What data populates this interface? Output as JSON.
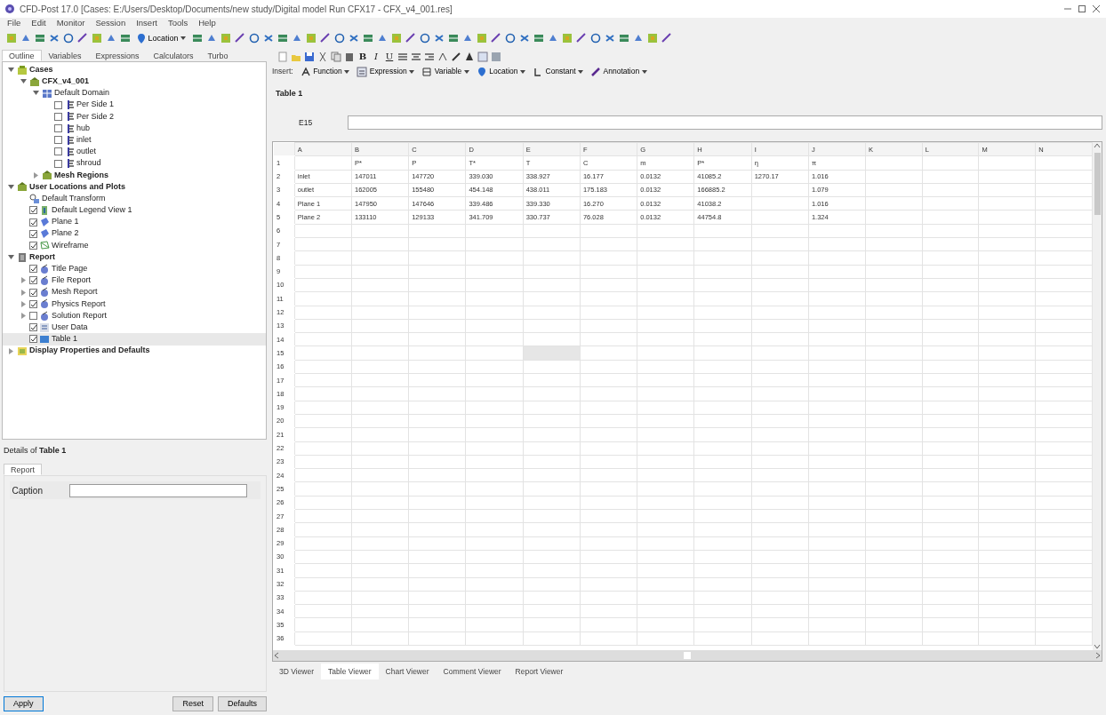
{
  "window": {
    "title": "CFD-Post 17.0 [Cases: E:/Users/Desktop/Documents/new study/Digital model Run CFX17 - CFX_v4_001.res]"
  },
  "menu": [
    "File",
    "Edit",
    "Monitor",
    "Session",
    "Insert",
    "Tools",
    "Help"
  ],
  "toolbar": {
    "location_button": "Location"
  },
  "left_tabs": [
    {
      "label": "Outline",
      "selected": true
    },
    {
      "label": "Variables",
      "selected": false
    },
    {
      "label": "Expressions",
      "selected": false
    },
    {
      "label": "Calculators",
      "selected": false
    },
    {
      "label": "Turbo",
      "selected": false
    }
  ],
  "tree": [
    {
      "label": "Cases",
      "kind": "folder",
      "bold": true,
      "expanded": true,
      "children": [
        {
          "label": "CFX_v4_001",
          "kind": "case",
          "bold": true,
          "expanded": true,
          "children": [
            {
              "label": "Default Domain",
              "kind": "domain",
              "bold": false,
              "expanded": true,
              "children": [
                {
                  "label": "Per Side 1",
                  "kind": "boundary",
                  "bold": false,
                  "checked": false
                },
                {
                  "label": "Per Side 2",
                  "kind": "boundary",
                  "bold": false,
                  "checked": false
                },
                {
                  "label": "hub",
                  "kind": "boundary",
                  "bold": false,
                  "checked": false
                },
                {
                  "label": "inlet",
                  "kind": "boundary",
                  "bold": false,
                  "checked": false
                },
                {
                  "label": "outlet",
                  "kind": "boundary",
                  "bold": false,
                  "checked": false
                },
                {
                  "label": "shroud",
                  "kind": "boundary",
                  "bold": false,
                  "checked": false
                }
              ]
            },
            {
              "label": "Mesh Regions",
              "kind": "case",
              "bold": true,
              "expanded": false
            }
          ]
        }
      ]
    },
    {
      "label": "User Locations and Plots",
      "kind": "case",
      "bold": true,
      "expanded": true,
      "children": [
        {
          "label": "Default Transform",
          "kind": "transform",
          "bold": false
        },
        {
          "label": "Default Legend View 1",
          "kind": "legend",
          "bold": false,
          "checked": true
        },
        {
          "label": "Plane 1",
          "kind": "plane",
          "bold": false,
          "checked": true
        },
        {
          "label": "Plane 2",
          "kind": "plane",
          "bold": false,
          "checked": true
        },
        {
          "label": "Wireframe",
          "kind": "wireframe",
          "bold": false,
          "checked": true
        }
      ]
    },
    {
      "label": "Report",
      "kind": "report",
      "bold": true,
      "expanded": true,
      "children": [
        {
          "label": "Title Page",
          "kind": "page",
          "bold": false,
          "checked": true
        },
        {
          "label": "File Report",
          "kind": "page",
          "bold": false,
          "checked": true,
          "expanded": false
        },
        {
          "label": "Mesh Report",
          "kind": "page",
          "bold": false,
          "checked": true,
          "expanded": false
        },
        {
          "label": "Physics Report",
          "kind": "page",
          "bold": false,
          "checked": true,
          "expanded": false
        },
        {
          "label": "Solution Report",
          "kind": "page",
          "bold": false,
          "checked": false,
          "expanded": false
        },
        {
          "label": "User Data",
          "kind": "data",
          "bold": false,
          "checked": true
        },
        {
          "label": "Table 1",
          "kind": "table",
          "bold": false,
          "checked": true,
          "selected": true
        }
      ]
    },
    {
      "label": "Display Properties and Defaults",
      "kind": "settings",
      "bold": true,
      "expanded": false
    }
  ],
  "details": {
    "title_prefix": "Details of ",
    "title_name": "Table 1",
    "tabs": [
      {
        "label": "Report",
        "selected": true
      }
    ],
    "caption_label": "Caption",
    "buttons": [
      "Apply",
      "Reset",
      "Defaults"
    ]
  },
  "format_buttons": [
    "B",
    "I",
    "U"
  ],
  "insert_toolbar": {
    "label": "Insert:",
    "items": [
      "Function",
      "Expression",
      "Variable",
      "Location",
      "Constant",
      "Annotation"
    ]
  },
  "table_title": "Table 1",
  "cell_reference": "E15",
  "table": {
    "columns": [
      "A",
      "B",
      "C",
      "D",
      "E",
      "F",
      "G",
      "H",
      "I",
      "J",
      "K",
      "L",
      "M",
      "N"
    ],
    "rows": [
      {
        "number": "1",
        "cells": [
          "",
          "P*",
          "P",
          "T*",
          "T",
          "C",
          "m",
          "P*",
          "η",
          "π"
        ]
      },
      {
        "number": "2",
        "cells": [
          "inlet",
          "147011",
          "147720",
          "339.030",
          "338.927",
          "16.177",
          "0.0132",
          "41085.2",
          "1270.17",
          "1.016"
        ]
      },
      {
        "number": "3",
        "cells": [
          "outlet",
          "162005",
          "155480",
          "454.148",
          "438.011",
          "175.183",
          "0.0132",
          "166885.2",
          "",
          "1.079"
        ]
      },
      {
        "number": "4",
        "cells": [
          "Plane 1",
          "147950",
          "147646",
          "339.486",
          "339.330",
          "16.270",
          "0.0132",
          "41038.2",
          "",
          "1.016"
        ]
      },
      {
        "number": "5",
        "cells": [
          "Plane 2",
          "133110",
          "129133",
          "341.709",
          "330.737",
          "76.028",
          "0.0132",
          "44754.8",
          "",
          "1.324"
        ]
      },
      {
        "number": "6"
      },
      {
        "number": "7"
      },
      {
        "number": "8"
      },
      {
        "number": "9"
      },
      {
        "number": "10"
      },
      {
        "number": "11"
      },
      {
        "number": "12"
      },
      {
        "number": "13"
      },
      {
        "number": "14"
      },
      {
        "number": "15",
        "selected": true
      },
      {
        "number": "16"
      },
      {
        "number": "17"
      },
      {
        "number": "18"
      },
      {
        "number": "19"
      },
      {
        "number": "20"
      },
      {
        "number": "21"
      },
      {
        "number": "22"
      },
      {
        "number": "23"
      },
      {
        "number": "24"
      },
      {
        "number": "25"
      },
      {
        "number": "26"
      },
      {
        "number": "27"
      },
      {
        "number": "28"
      },
      {
        "number": "29"
      },
      {
        "number": "30"
      },
      {
        "number": "31"
      },
      {
        "number": "32"
      },
      {
        "number": "33"
      },
      {
        "number": "34"
      },
      {
        "number": "35"
      },
      {
        "number": "36"
      }
    ]
  },
  "viewer_tabs": [
    {
      "label": "3D Viewer",
      "selected": false
    },
    {
      "label": "Table Viewer",
      "selected": true
    },
    {
      "label": "Chart Viewer",
      "selected": false
    },
    {
      "label": "Comment Viewer",
      "selected": false
    },
    {
      "label": "Report Viewer",
      "selected": false
    }
  ]
}
